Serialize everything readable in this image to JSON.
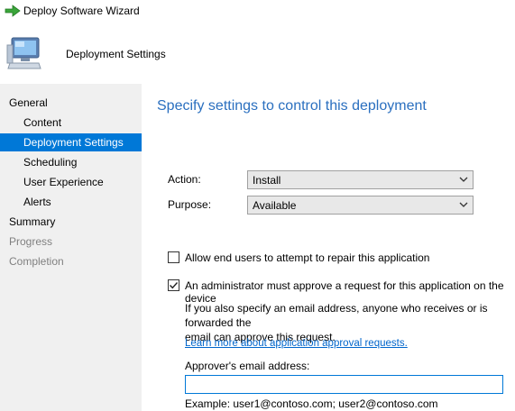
{
  "window": {
    "title": "Deploy Software Wizard"
  },
  "header": {
    "heading": "Deployment Settings"
  },
  "sidebar": {
    "items": [
      {
        "label": "General",
        "state": "normal"
      },
      {
        "label": "Content",
        "state": "normal"
      },
      {
        "label": "Deployment Settings",
        "state": "selected"
      },
      {
        "label": "Scheduling",
        "state": "normal"
      },
      {
        "label": "User Experience",
        "state": "normal"
      },
      {
        "label": "Alerts",
        "state": "normal"
      },
      {
        "label": "Summary",
        "state": "normal"
      },
      {
        "label": "Progress",
        "state": "disabled"
      },
      {
        "label": "Completion",
        "state": "disabled"
      }
    ]
  },
  "main": {
    "title": "Specify settings to control this deployment",
    "action": {
      "label": "Action:",
      "value": "Install"
    },
    "purpose": {
      "label": "Purpose:",
      "value": "Available"
    },
    "repair_checkbox": {
      "label": "Allow end users to attempt to repair this application",
      "checked": false
    },
    "approval_checkbox": {
      "label": "An administrator must approve a request for this application on the device",
      "checked": true
    },
    "approval_desc_line1": "If you also specify an email address, anyone who receives or is forwarded the",
    "approval_desc_line2": "email can approve this request.",
    "learn_more_link": "Learn more about application approval requests.",
    "email_label": "Approver's email address:",
    "email_value": "",
    "email_example": "Example: user1@contoso.com; user2@contoso.com"
  },
  "colors": {
    "accent": "#0078d7",
    "title_blue": "#2a6fbf",
    "sidebar_bg": "#f0f0f0"
  }
}
